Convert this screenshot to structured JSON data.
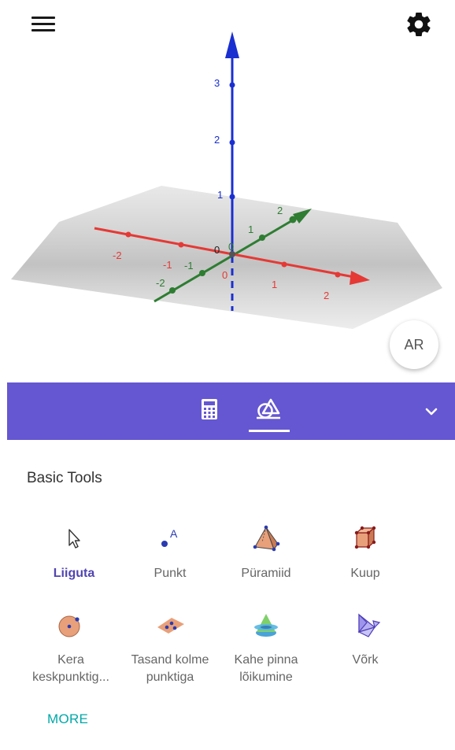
{
  "app": {
    "menu_icon": "hamburger-menu-icon",
    "settings_icon": "gear-icon"
  },
  "graphics3d": {
    "z_axis_ticks": [
      "1",
      "2",
      "3"
    ],
    "x_axis_ticks": [
      "-2",
      "-1",
      "0",
      "1",
      "2"
    ],
    "y_axis_ticks": [
      "-2",
      "-1",
      "0",
      "1",
      "2"
    ],
    "origin_label": "0",
    "colors": {
      "x_axis": "#e53935",
      "y_axis": "#2e7d32",
      "z_axis": "#1a2fd0",
      "plane": "#c7c7c7"
    }
  },
  "ar_button": {
    "label": "AR"
  },
  "toolbar": {
    "background": "#6557d2",
    "tabs": [
      {
        "icon": "calculator-icon",
        "selected": false
      },
      {
        "icon": "shapes-tools-icon",
        "selected": true
      }
    ],
    "collapse_icon": "chevron-down-icon"
  },
  "tools_panel": {
    "title": "Basic Tools",
    "tools": [
      {
        "label": "Liiguta",
        "icon": "move-cursor-icon",
        "selected": true
      },
      {
        "label": "Punkt",
        "icon": "point-icon",
        "selected": false
      },
      {
        "label": "Püramiid",
        "icon": "pyramid-icon",
        "selected": false
      },
      {
        "label": "Kuup",
        "icon": "cube-icon",
        "selected": false
      },
      {
        "label_line1": "Kera",
        "label_line2": "keskpunktig...",
        "icon": "sphere-center-icon",
        "selected": false
      },
      {
        "label_line1": "Tasand kolme",
        "label_line2": "punktiga",
        "icon": "plane-three-points-icon",
        "selected": false
      },
      {
        "label_line1": "Kahe pinna",
        "label_line2": "lõikumine",
        "icon": "intersect-surfaces-icon",
        "selected": false
      },
      {
        "label": "Võrk",
        "icon": "net-icon",
        "selected": false
      }
    ],
    "more_label": "MORE"
  }
}
